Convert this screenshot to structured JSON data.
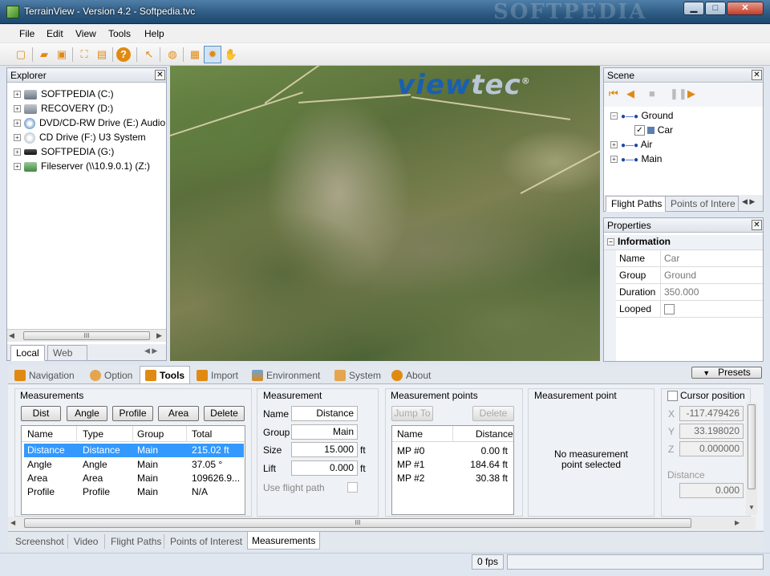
{
  "window": {
    "title": "TerrainView - Version 4.2 - Softpedia.tvc",
    "watermark": "SOFTPEDIA"
  },
  "menu": [
    "File",
    "Edit",
    "View",
    "Tools",
    "Help"
  ],
  "toolbar_icons": [
    "new-icon",
    "open-icon",
    "save-icon",
    "fit-icon",
    "layout-icon",
    "help-icon",
    "pointer-icon",
    "globe-icon",
    "grid-icon",
    "sun-icon",
    "hand-icon"
  ],
  "explorer": {
    "title": "Explorer",
    "drives": [
      {
        "label": "SOFTPEDIA (C:)",
        "icon": "hdd-icon"
      },
      {
        "label": "RECOVERY (D:)",
        "icon": "hdd-icon"
      },
      {
        "label": "DVD/CD-RW Drive (E:) Audio",
        "icon": "dvd-icon"
      },
      {
        "label": "CD Drive (F:) U3 System",
        "icon": "cd-icon"
      },
      {
        "label": "SOFTPEDIA (G:)",
        "icon": "removable-icon"
      },
      {
        "label": "Fileserver (\\\\10.9.0.1) (Z:)",
        "icon": "network-drive-icon"
      }
    ],
    "tabs": [
      "Local",
      "Web"
    ],
    "scroll_glyph": "III"
  },
  "viewport": {
    "logo_a": "view",
    "logo_b": "tec",
    "reg": "®"
  },
  "scene": {
    "title": "Scene",
    "tree": [
      {
        "label": "Ground",
        "expanded": true,
        "children": [
          {
            "label": "Car",
            "checked": true
          }
        ]
      },
      {
        "label": "Air"
      },
      {
        "label": "Main"
      }
    ],
    "tabs": [
      "Flight Paths",
      "Points of Intere"
    ]
  },
  "properties": {
    "title": "Properties",
    "section": "Information",
    "rows": [
      {
        "name": "Name",
        "value": "Car"
      },
      {
        "name": "Group",
        "value": "Ground"
      },
      {
        "name": "Duration",
        "value": "350.000"
      },
      {
        "name": "Looped",
        "value": ""
      }
    ]
  },
  "tool_tabs": [
    "Navigation",
    "Option",
    "Tools",
    "Import",
    "Environment",
    "System",
    "About"
  ],
  "presets_label": "Presets",
  "measurements": {
    "title": "Measurements",
    "buttons": [
      "Dist",
      "Angle",
      "Profile",
      "Area",
      "Delete"
    ],
    "columns": [
      "Name",
      "Type",
      "Group",
      "Total"
    ],
    "rows": [
      [
        "Distance",
        "Distance",
        "Main",
        "215.02 ft"
      ],
      [
        "Angle",
        "Angle",
        "Main",
        "37.05 °"
      ],
      [
        "Area",
        "Area",
        "Main",
        "109626.9..."
      ],
      [
        "Profile",
        "Profile",
        "Main",
        "N/A"
      ]
    ]
  },
  "measurement": {
    "title": "Measurement",
    "name_label": "Name",
    "name_value": "Distance",
    "group_label": "Group",
    "group_value": "Main",
    "size_label": "Size",
    "size_value": "15.000",
    "size_unit": "ft",
    "lift_label": "Lift",
    "lift_value": "0.000",
    "lift_unit": "ft",
    "flight_label": "Use flight path"
  },
  "points": {
    "title": "Measurement points",
    "jump_label": "Jump To",
    "delete_label": "Delete",
    "columns": [
      "Name",
      "Distance"
    ],
    "rows": [
      [
        "MP #0",
        "0.00 ft"
      ],
      [
        "MP #1",
        "184.64 ft"
      ],
      [
        "MP #2",
        "30.38 ft"
      ]
    ]
  },
  "point": {
    "title": "Measurement point",
    "empty_line1": "No measurement",
    "empty_line2": "point selected"
  },
  "cursor": {
    "title": "Cursor position",
    "x_label": "X",
    "x_value": "-117.479426",
    "y_label": "Y",
    "y_value": "33.198020",
    "z_label": "Z",
    "z_value": "0.000000",
    "distance_label": "Distance",
    "distance_value": "0.000"
  },
  "dock_tabs": [
    "Screenshot",
    "Video",
    "Flight Paths",
    "Points of Interest",
    "Measurements"
  ],
  "statusbar": {
    "fps": "0 fps"
  }
}
